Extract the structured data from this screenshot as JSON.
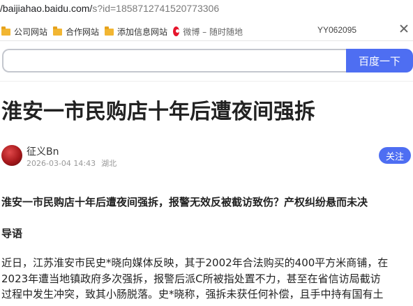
{
  "browser": {
    "url_host": "/baijiahao.baidu.com/",
    "url_query": "s?id=1858712741520773306"
  },
  "bookmarks": {
    "items": [
      {
        "label": "公司网站",
        "icon": "folder-icon"
      },
      {
        "label": "合作网站",
        "icon": "folder-icon"
      },
      {
        "label": "添加信息网站",
        "icon": "folder-icon"
      },
      {
        "label": "微博 – 随时随地",
        "icon": "weibo-icon"
      }
    ],
    "right_text": "YY062095"
  },
  "search": {
    "value": "",
    "button_label": "百度一下"
  },
  "article": {
    "title": "淮安一市民购店十年后遭夜间强拆",
    "author": "征义Bn",
    "datetime": "2026-03-04 14:43",
    "location": "湖北",
    "follow_label": "关注",
    "subtitle": "淮安一市民购店十年后遭夜间强拆，报警无效反被截访致伤？产权纠纷悬而未决",
    "section_heading": "导语",
    "paragraph_lines": [
      "近日，江苏淮安市民史*晓向媒体反映，其于2002年合法购买的400平方米商铺，在",
      "2023年遭当地镇政府多次强拆，报警后派C所被指处置不力，甚至在省信访局截访",
      "过程中发生冲突，致其小肠脱落。史*晓称，强拆未获任何补偿，且手中持有国有土"
    ]
  },
  "colors": {
    "accent": "#4e6ef2",
    "folder": "#f2b632",
    "weibo": "#e6162d"
  }
}
